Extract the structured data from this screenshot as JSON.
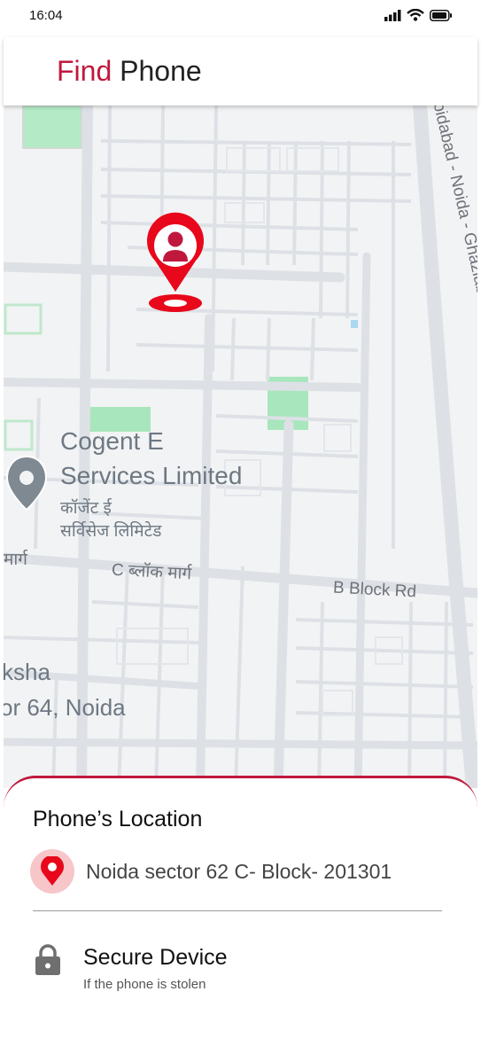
{
  "status_bar": {
    "time": "16:04"
  },
  "header": {
    "title_accent": "Find",
    "title_rest": "Phone"
  },
  "map": {
    "poi_name_line1": "Cogent E",
    "poi_name_line2": "Services Limited",
    "poi_hindi_line1": "कॉजेंट ई",
    "poi_hindi_line2": "सर्विसेज लिमिटेड",
    "road_left": "मार्ग",
    "road_c_block": "C ब्लॉक मार्ग",
    "road_b_block": "B Block Rd",
    "expressway": "ibidabad - Noida - Ghaziabad Expy",
    "area_line1": "ksha",
    "area_line2": "or 64, Noida"
  },
  "sheet": {
    "title": "Phone’s Location",
    "location_text": "Noida sector 62 C- Block- 201301",
    "secure_title": "Secure Device",
    "secure_subtitle": "If the phone is stolen"
  },
  "colors": {
    "accent": "#c0183d",
    "pin_red": "#e8071b",
    "map_bg": "#f2f3f4",
    "park_green": "#a8e6bd"
  }
}
